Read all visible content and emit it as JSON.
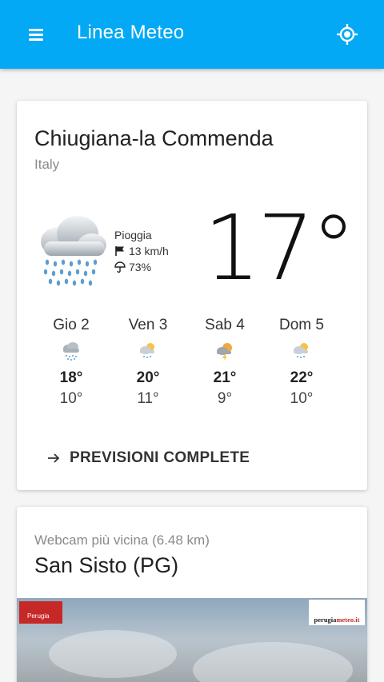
{
  "appbar": {
    "title": "Linea Meteo"
  },
  "current": {
    "location": "Chiugiana-la Commenda",
    "country": "Italy",
    "condition": "Pioggia",
    "wind": "13 km/h",
    "rain_prob": "73%",
    "temperature": "17°"
  },
  "forecast": [
    {
      "day": "Gio 2",
      "icon": "rain-cloud-icon",
      "high": "18°",
      "low": "10°"
    },
    {
      "day": "Ven 3",
      "icon": "cloud-sun-rain-icon",
      "high": "20°",
      "low": "11°"
    },
    {
      "day": "Sab 4",
      "icon": "sun-storm-icon",
      "high": "21°",
      "low": "9°"
    },
    {
      "day": "Dom 5",
      "icon": "cloud-sun-rain-icon",
      "high": "22°",
      "low": "10°"
    }
  ],
  "full_forecast_label": "PREVISIONI COMPLETE",
  "webcam": {
    "subtitle": "Webcam più vicina (6.48 km)",
    "title": "San Sisto (PG)",
    "logo_left_text": "Perugia",
    "logo_right_text_a": "perugia",
    "logo_right_text_b": "meteo.it"
  },
  "colors": {
    "appbar": "#03a9f4",
    "background": "#f5f5f5",
    "card": "#ffffff"
  }
}
